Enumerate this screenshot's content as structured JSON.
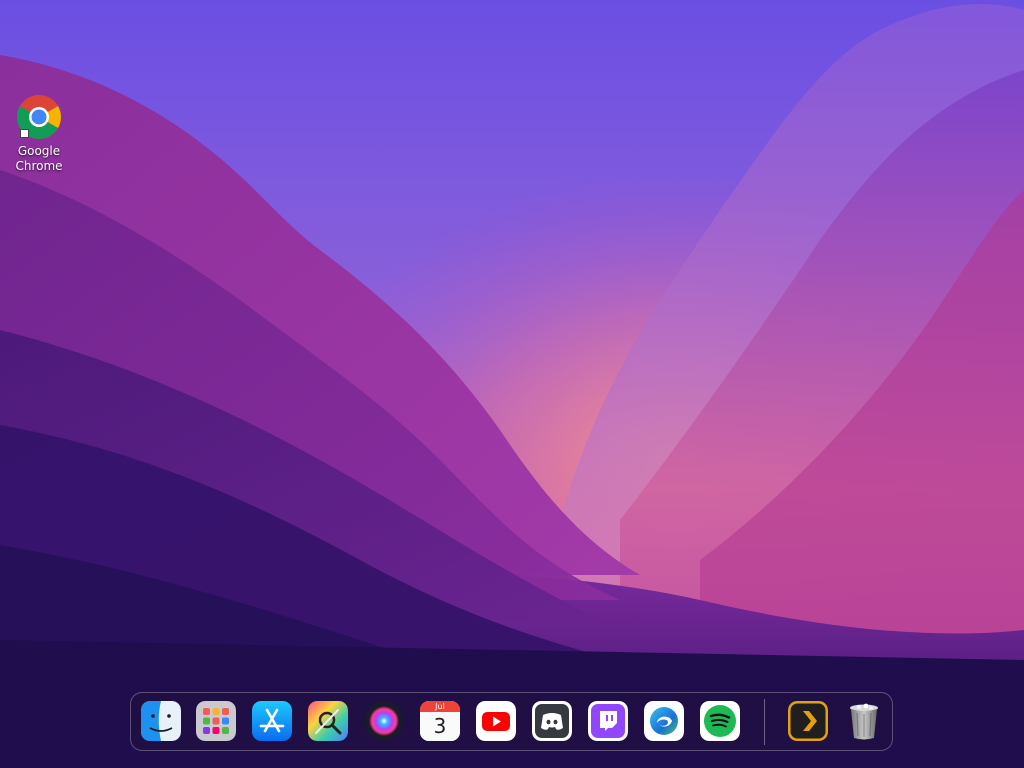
{
  "desktop": {
    "icons": [
      {
        "label": "Google Chrome",
        "icon": "chrome-icon"
      }
    ]
  },
  "dock": {
    "items": [
      {
        "name": "finder",
        "icon": "finder-icon"
      },
      {
        "name": "launchpad",
        "icon": "launchpad-icon"
      },
      {
        "name": "app-store",
        "icon": "app-store-icon"
      },
      {
        "name": "system-utilities",
        "icon": "tools-icon"
      },
      {
        "name": "siri",
        "icon": "siri-icon"
      },
      {
        "name": "calendar",
        "icon": "calendar-icon",
        "month": "Jul",
        "day": "3"
      },
      {
        "name": "youtube",
        "icon": "youtube-icon"
      },
      {
        "name": "discord",
        "icon": "discord-icon"
      },
      {
        "name": "twitch",
        "icon": "twitch-icon"
      },
      {
        "name": "edge",
        "icon": "edge-icon"
      },
      {
        "name": "spotify",
        "icon": "spotify-icon"
      },
      {
        "name": "plex",
        "icon": "plex-icon"
      },
      {
        "name": "trash",
        "icon": "trash-icon"
      }
    ]
  },
  "colors": {
    "sky_top": "#6a4fe0",
    "sky_glow": "#f07a8a",
    "mountain_deep": "#2a0f5c",
    "accent_red": "#ff0000",
    "spotify_green": "#1db954",
    "plex_orange": "#e5a00d",
    "twitch_purple": "#9146ff",
    "discord_blue": "#5865f2"
  }
}
